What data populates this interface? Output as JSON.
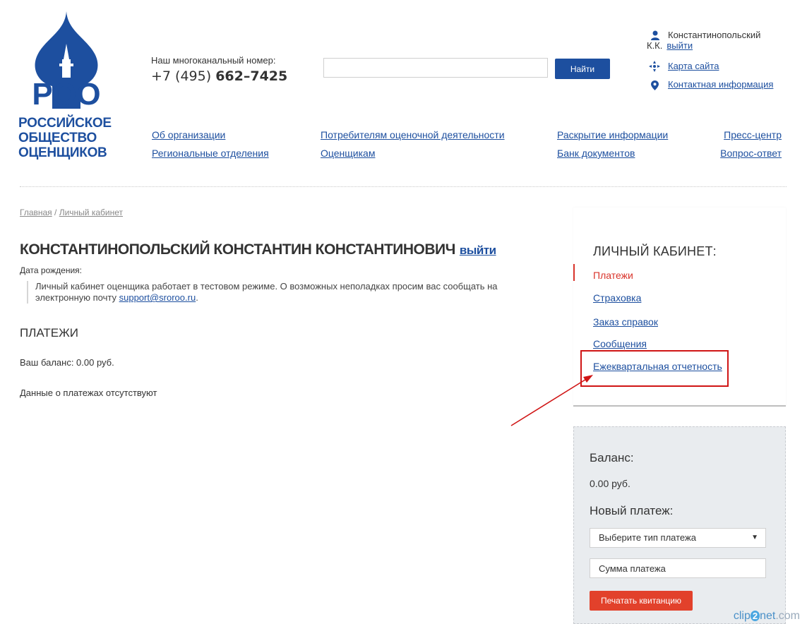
{
  "logo": {
    "lettering": "РОО",
    "lines": [
      "РОССИЙСКОЕ",
      "ОБЩЕСТВО",
      "ОЦЕНЩИКОВ"
    ],
    "color": "#1d4f9f"
  },
  "header": {
    "phone_label": "Наш многоканальный номер:",
    "phone_prefix": "+7 (495) ",
    "phone_number": "662–7425",
    "search_placeholder": "",
    "search_button": "Найти",
    "user_name": "Константинопольский",
    "user_initials": "К.К.",
    "user_exit": "выйти",
    "sitemap": "Карта сайта",
    "contact": "Контактная информация"
  },
  "nav": {
    "col1": [
      "Об организации",
      "Региональные отделения"
    ],
    "col2": [
      "Потребителям оценочной деятельности",
      "Оценщикам"
    ],
    "col3": [
      "Раскрытие информации",
      "Банк документов"
    ],
    "col4": [
      "Пресс-центр",
      "Вопрос-ответ"
    ]
  },
  "breadcrumb": {
    "home": "Главная",
    "sep": " / ",
    "current": "Личный кабинет"
  },
  "main": {
    "title": "КОНСТАНТИНОПОЛЬСКИЙ КОНСТАНТИН КОНСТАНТИНОВИЧ",
    "title_exit": "выйти",
    "birth": "Дата рождения:",
    "notice_text": "Личный кабинет оценщика работает в тестовом режиме. О возможных неполадках просим вас сообщать на электронную почту ",
    "notice_email": "support@sroroo.ru",
    "notice_end": ".",
    "section": "ПЛАТЕЖИ",
    "balance": "Ваш баланс: 0.00 руб.",
    "nodata": "Данные о платежах отсутствуют"
  },
  "sidebar": {
    "title": "ЛИЧНЫЙ КАБИНЕТ:",
    "items": [
      "Платежи",
      "Страховка",
      "Заказ справок",
      "Сообщения",
      "Ежеквартальная отчетность"
    ],
    "active_index": 0
  },
  "payment": {
    "balance_label": "Баланс:",
    "balance_value": "0.00 руб.",
    "new_label": "Новый платеж:",
    "select_value": "Выберите тип платежа",
    "amount_placeholder": "Сумма платежа",
    "print_button": "Печатать квитанцию"
  },
  "watermark": {
    "a": "clip",
    "b": "2",
    "c": "net",
    "d": ".com"
  },
  "colors": {
    "brand": "#1d4f9f",
    "accent": "#d9342b",
    "button_red": "#e2412b",
    "annotation": "#d01515"
  }
}
